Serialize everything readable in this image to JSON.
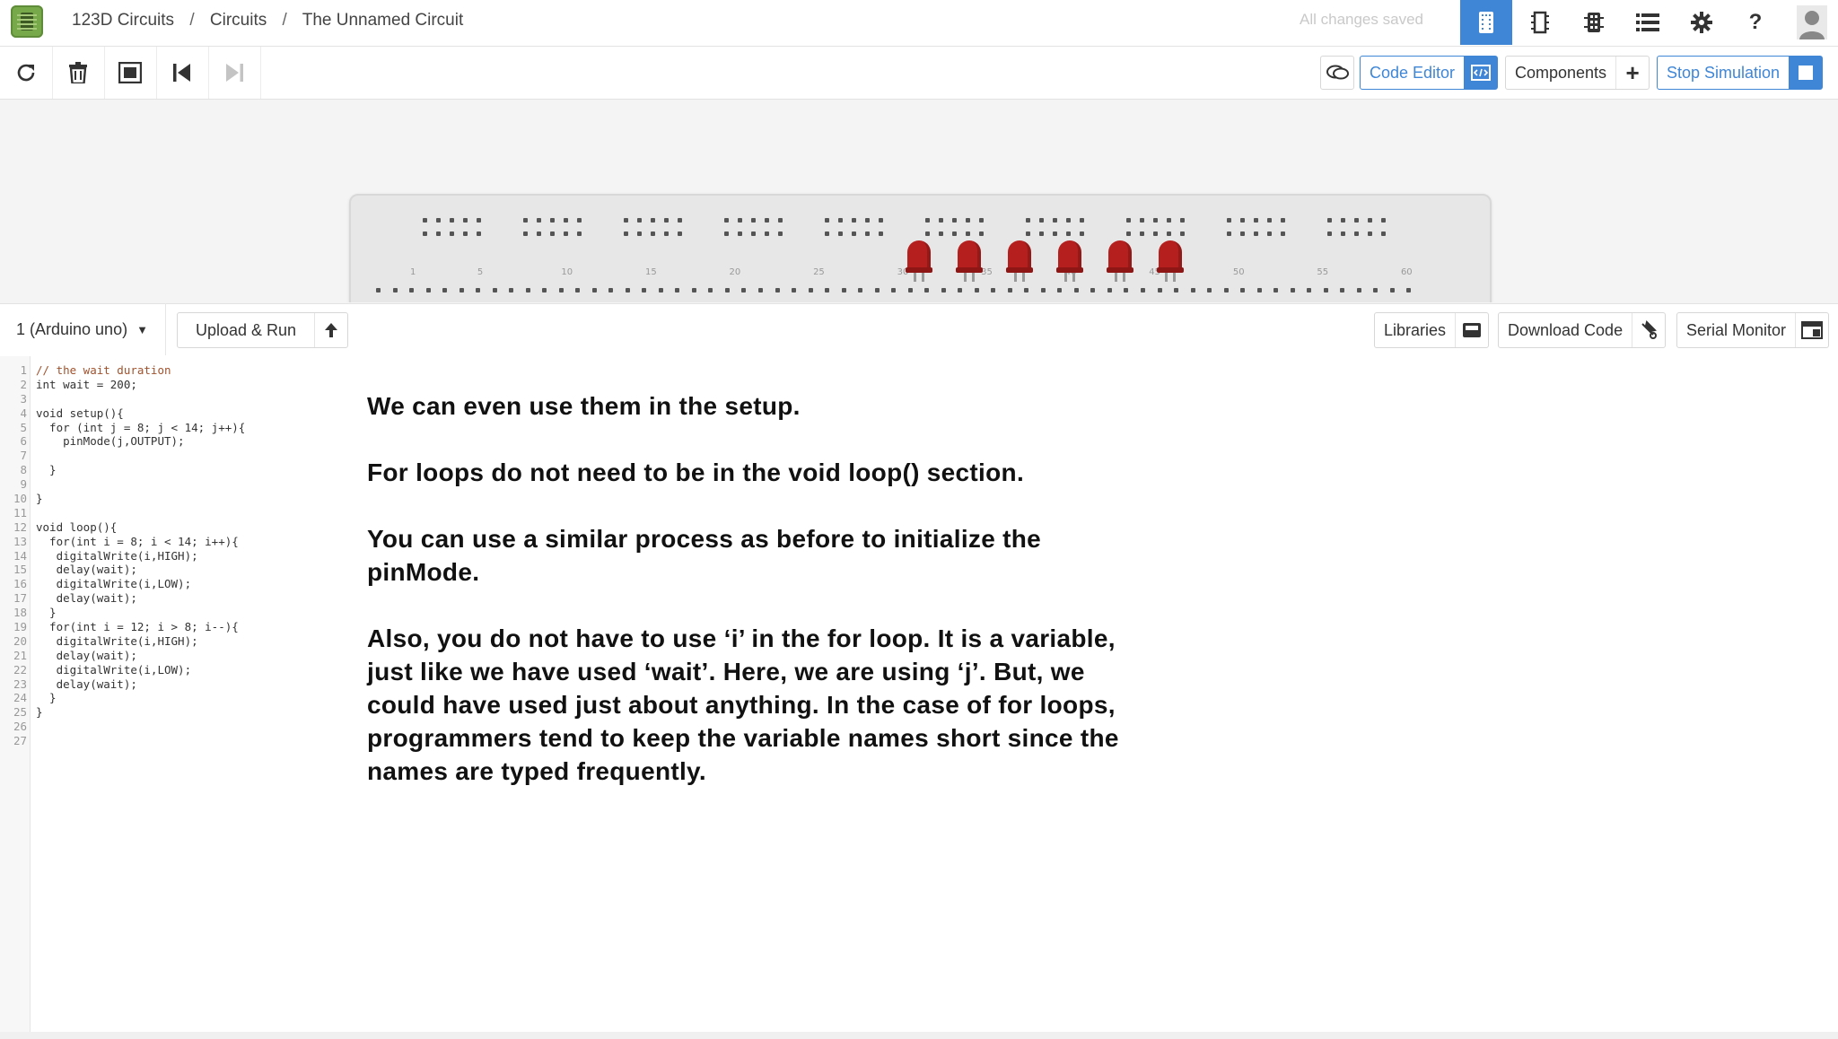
{
  "header": {
    "breadcrumbs": [
      "123D Circuits",
      "Circuits",
      "The Unnamed Circuit"
    ],
    "separator": "/",
    "save_status": "All changes saved",
    "icons": [
      "breadboard-view-icon",
      "schematic-view-icon",
      "pcb-view-icon",
      "list-view-icon",
      "settings-icon",
      "help-icon",
      "user-avatar-icon"
    ]
  },
  "toolbar": {
    "tools": [
      "rotate-icon",
      "delete-icon",
      "fit-view-icon",
      "step-back-icon",
      "step-forward-icon"
    ],
    "code_editor_label": "Code Editor",
    "components_label": "Components",
    "stop_simulation_label": "Stop Simulation"
  },
  "breadboard": {
    "column_numbers": [
      "1",
      "5",
      "10",
      "15",
      "20",
      "25",
      "30",
      "35",
      "40",
      "45",
      "50",
      "55",
      "60"
    ],
    "led_count": 6,
    "led_color": "#b5201f"
  },
  "editor": {
    "device_selector": "1 (Arduino uno)",
    "upload_label": "Upload & Run",
    "libraries_label": "Libraries",
    "download_label": "Download Code",
    "serial_label": "Serial Monitor"
  },
  "code_lines": [
    "// the wait duration",
    "int wait = 200;",
    "",
    "void setup(){",
    "  for (int j = 8; j < 14; j++){",
    "    pinMode(j,OUTPUT);",
    "",
    "  }",
    "",
    "}",
    "",
    "void loop(){",
    "  for(int i = 8; i < 14; i++){",
    "   digitalWrite(i,HIGH);",
    "   delay(wait);",
    "   digitalWrite(i,LOW);",
    "   delay(wait);",
    "  }",
    "  for(int i = 12; i > 8; i--){",
    "   digitalWrite(i,HIGH);",
    "   delay(wait);",
    "   digitalWrite(i,LOW);",
    "   delay(wait);",
    "  }",
    "}",
    "",
    ""
  ],
  "notes": [
    "We can even use them in the setup.",
    "For loops do not need to be in the void loop() section.",
    "You can use a similar process as before to initialize the pinMode.",
    "Also, you do not have to use ‘i’ in the for loop. It is a variable, just like we have used ‘wait’. Here, we are using ‘j’. But, we could have used just about anything. In the case of for loops, programmers tend to keep the variable names short since the names are typed frequently."
  ],
  "colors": {
    "accent": "#3f86d6",
    "logo": "#77a84a"
  }
}
